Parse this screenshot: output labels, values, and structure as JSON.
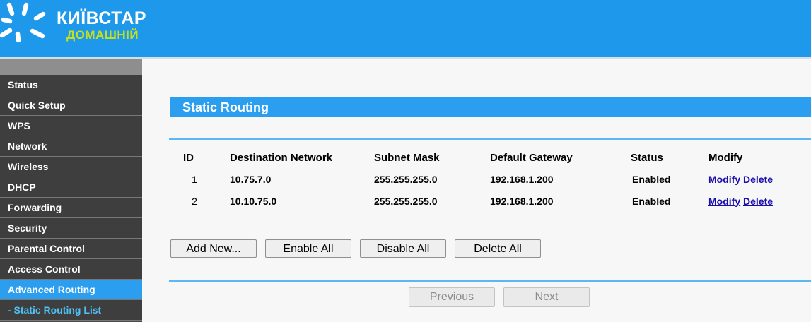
{
  "header": {
    "brand_line1": "КИЇВСТАР",
    "brand_line2": "ДОМАШНІЙ",
    "colors": {
      "header_bg": "#1e98ea",
      "brand_accent": "#c4e01d"
    }
  },
  "sidebar": {
    "items": [
      {
        "label": "Status"
      },
      {
        "label": "Quick Setup"
      },
      {
        "label": "WPS"
      },
      {
        "label": "Network"
      },
      {
        "label": "Wireless"
      },
      {
        "label": "DHCP"
      },
      {
        "label": "Forwarding"
      },
      {
        "label": "Security"
      },
      {
        "label": "Parental Control"
      },
      {
        "label": "Access Control"
      },
      {
        "label": "Advanced Routing",
        "active": true
      },
      {
        "label": "- Static Routing List",
        "sub": true
      }
    ]
  },
  "main": {
    "title": "Static Routing",
    "table": {
      "headers": [
        "ID",
        "Destination Network",
        "Subnet Mask",
        "Default Gateway",
        "Status",
        "Modify"
      ],
      "rows": [
        {
          "id": "1",
          "destination": "10.75.7.0",
          "mask": "255.255.255.0",
          "gateway": "192.168.1.200",
          "status": "Enabled",
          "modify": "Modify",
          "delete": "Delete"
        },
        {
          "id": "2",
          "destination": "10.10.75.0",
          "mask": "255.255.255.0",
          "gateway": "192.168.1.200",
          "status": "Enabled",
          "modify": "Modify",
          "delete": "Delete"
        }
      ]
    },
    "buttons": {
      "add_new": "Add New...",
      "enable_all": "Enable All",
      "disable_all": "Disable All",
      "delete_all": "Delete All"
    },
    "pager": {
      "previous": "Previous",
      "next": "Next"
    }
  }
}
